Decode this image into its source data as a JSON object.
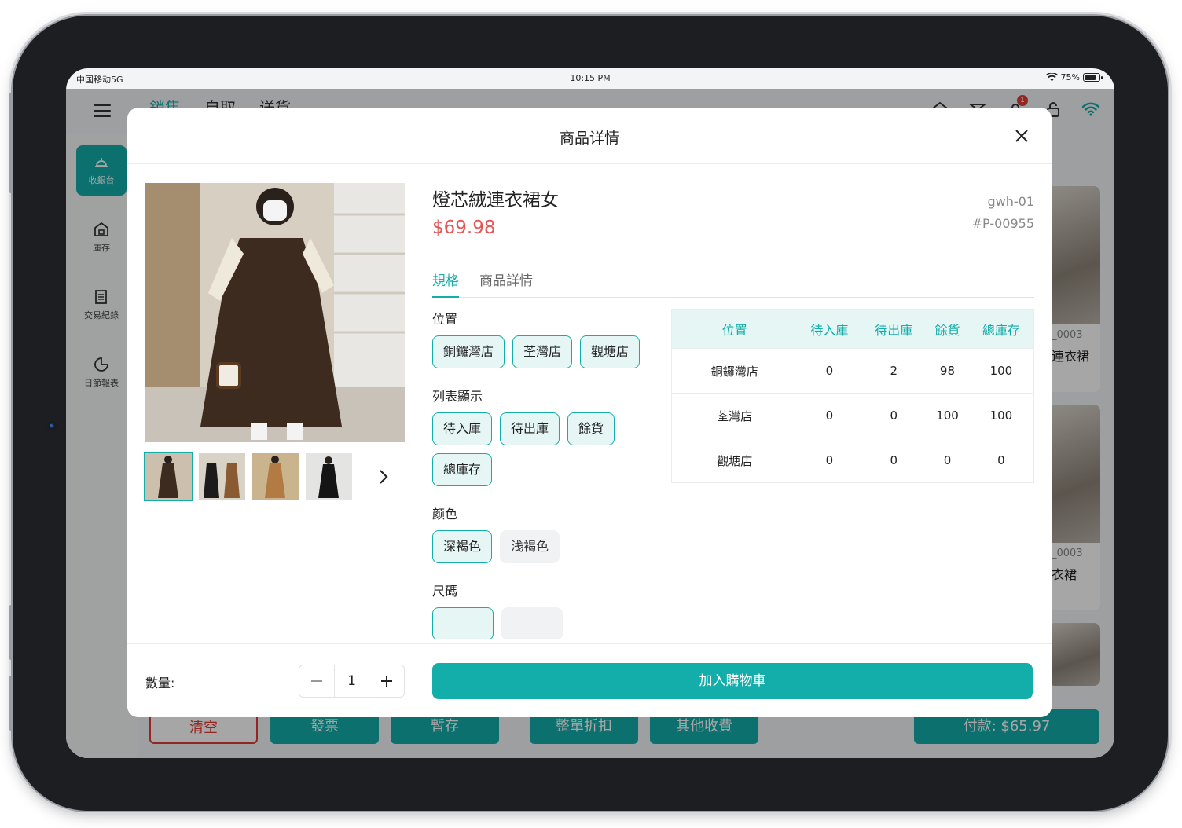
{
  "status_bar": {
    "carrier": "中国移动5G",
    "time": "10:15 PM",
    "battery": "75%"
  },
  "background": {
    "tabs": [
      "銷售",
      "自取",
      "送貨"
    ],
    "notification_count": "1",
    "sidebar": [
      {
        "label": "收銀台",
        "icon": "register-icon"
      },
      {
        "label": "庫存",
        "icon": "inventory-icon"
      },
      {
        "label": "交易紀錄",
        "icon": "receipt-icon"
      },
      {
        "label": "日節報表",
        "icon": "report-icon"
      }
    ],
    "cards": [
      {
        "code": "_0003",
        "name": "連衣裙"
      },
      {
        "code": "_0003",
        "name": "衣裙"
      }
    ],
    "bottom_buttons": [
      "清空",
      "發票",
      "暫存",
      "整單折扣",
      "其他收費"
    ],
    "pay_button": "付款: $65.97"
  },
  "modal": {
    "title": "商品详情",
    "product": {
      "name": "燈芯絨連衣裙女",
      "price": "$69.98",
      "code": "gwh-01",
      "sku": "#P-00955"
    },
    "tabs": [
      "規格",
      "商品詳情"
    ],
    "spec_groups": [
      {
        "title": "位置",
        "options": [
          {
            "label": "銅鑼灣店",
            "selected": true
          },
          {
            "label": "荃灣店",
            "selected": true
          },
          {
            "label": "觀塘店",
            "selected": true
          }
        ]
      },
      {
        "title": "列表顯示",
        "options": [
          {
            "label": "待入庫",
            "selected": true
          },
          {
            "label": "待出庫",
            "selected": true
          },
          {
            "label": "餘貨",
            "selected": true
          },
          {
            "label": "總庫存",
            "selected": true
          }
        ]
      },
      {
        "title": "颜色",
        "options": [
          {
            "label": "深褐色",
            "selected": true
          },
          {
            "label": "浅褐色",
            "selected": false
          }
        ]
      },
      {
        "title": "尺碼",
        "options": [
          {
            "label": "",
            "selected": true
          },
          {
            "label": "",
            "selected": false
          }
        ]
      }
    ],
    "stock_table": {
      "headers": [
        "位置",
        "待入庫",
        "待出庫",
        "餘貨",
        "總庫存"
      ],
      "rows": [
        [
          "銅鑼灣店",
          "0",
          "2",
          "98",
          "100"
        ],
        [
          "荃灣店",
          "0",
          "0",
          "100",
          "100"
        ],
        [
          "觀塘店",
          "0",
          "0",
          "0",
          "0"
        ]
      ]
    },
    "footer": {
      "qty_label": "數量:",
      "qty_value": "1",
      "add_to_cart": "加入購物車"
    }
  },
  "colors": {
    "accent": "#13aeaa",
    "price": "#e55555",
    "danger": "#e53935"
  }
}
